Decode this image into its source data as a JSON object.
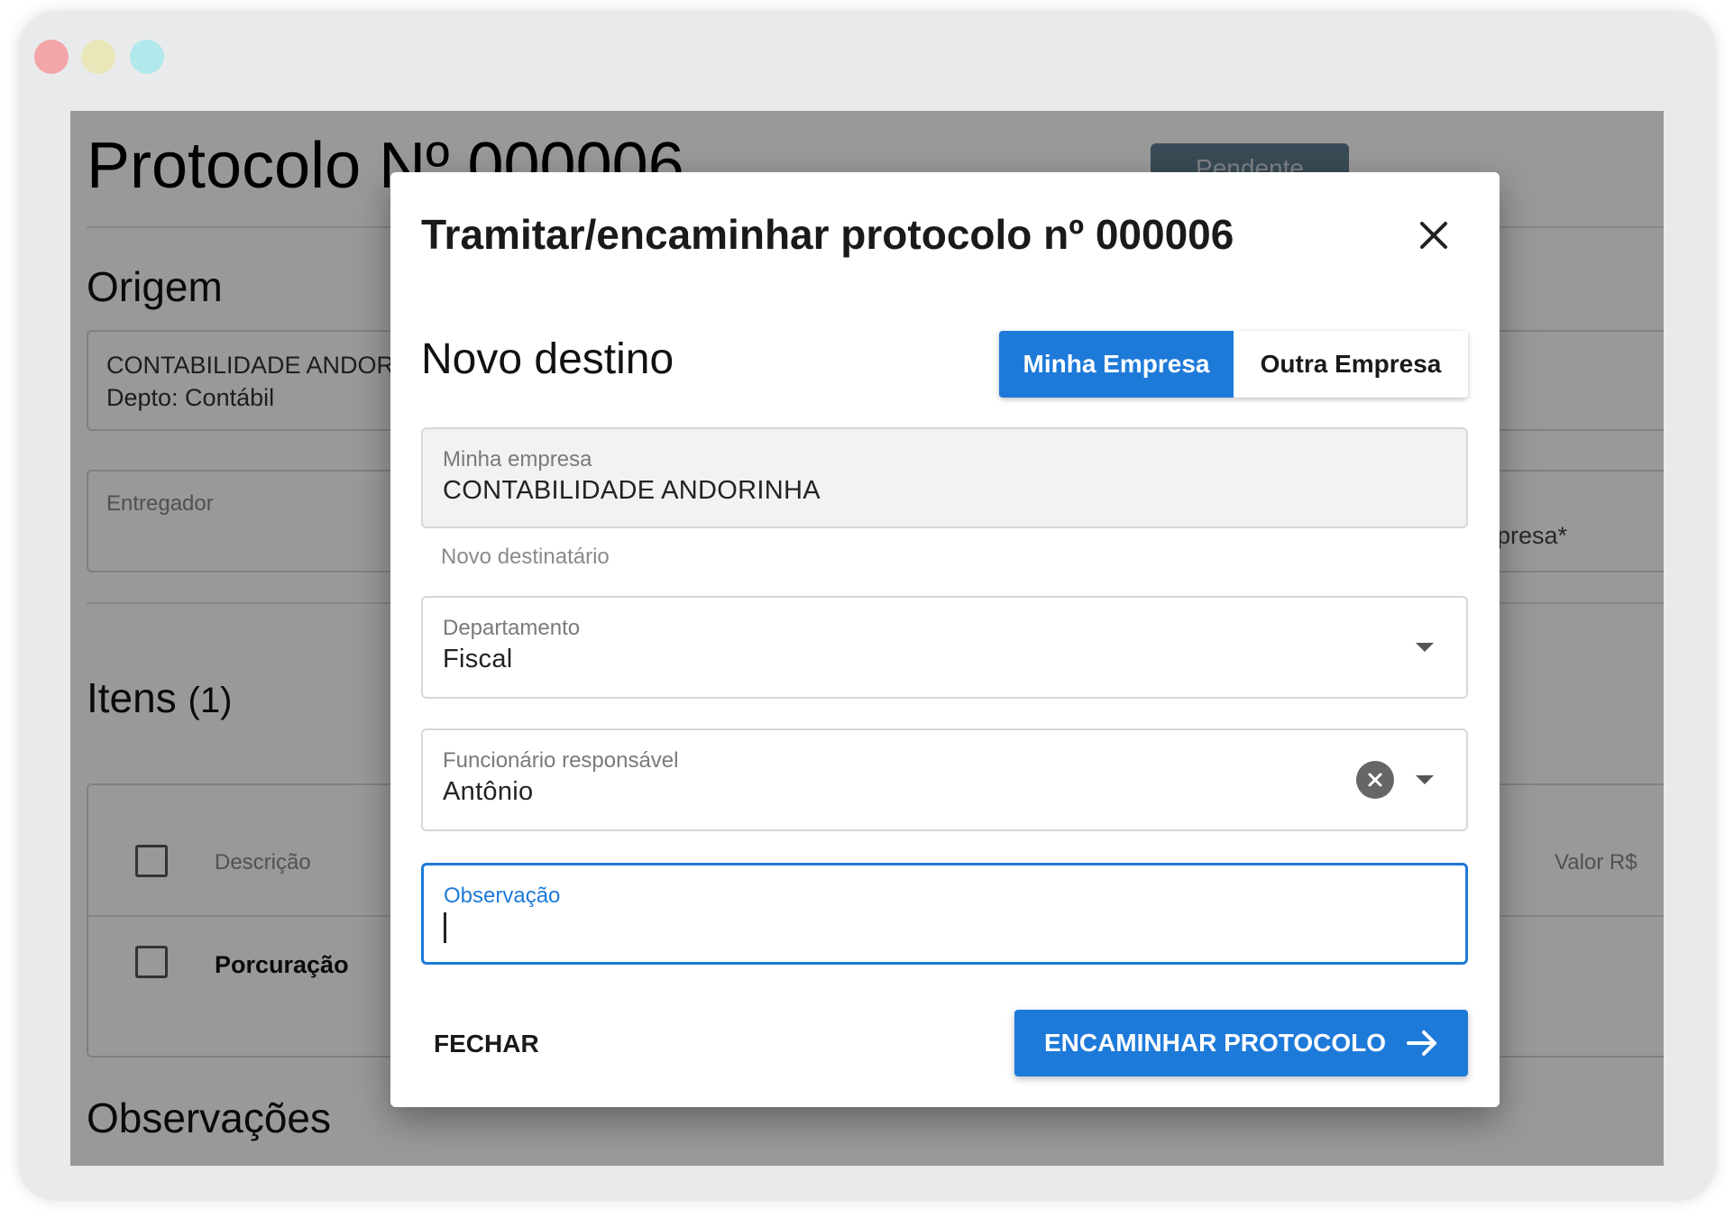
{
  "background_page": {
    "title": "Protocolo Nº 000006",
    "status_badge": "Pendente",
    "origem": {
      "title": "Origem",
      "company": "CONTABILIDADE ANDOR",
      "department": "Depto: Contábil",
      "entregador_label": "Entregador",
      "right_label": "presa*"
    },
    "itens": {
      "title": "Itens",
      "count": "(1)",
      "columns": {
        "description": "Descrição",
        "value": "Valor R$"
      },
      "rows": [
        {
          "description": "Porcuração"
        }
      ]
    },
    "observacoes_title": "Observações"
  },
  "dialog": {
    "title": "Tramitar/encaminhar protocolo nº 000006",
    "subtitle": "Novo destino",
    "toggle": {
      "option_active": "Minha Empresa",
      "option_other": "Outra Empresa"
    },
    "minha_empresa": {
      "label": "Minha empresa",
      "value": "CONTABILIDADE ANDORINHA"
    },
    "helper_text": "Novo destinatário",
    "departamento": {
      "label": "Departamento",
      "value": "Fiscal"
    },
    "funcionario": {
      "label": "Funcionário responsável",
      "value": "Antônio"
    },
    "observacao": {
      "label": "Observação",
      "value": ""
    },
    "buttons": {
      "close": "FECHAR",
      "submit": "ENCAMINHAR PROTOCOLO"
    }
  },
  "colors": {
    "primary": "#1e7ad9",
    "overlay": "rgba(0,0,0,0.4)"
  },
  "icons": {
    "close": "close-icon",
    "clear": "clear-circle-icon",
    "dropdown": "chevron-down-icon",
    "arrow": "arrow-right-icon"
  }
}
